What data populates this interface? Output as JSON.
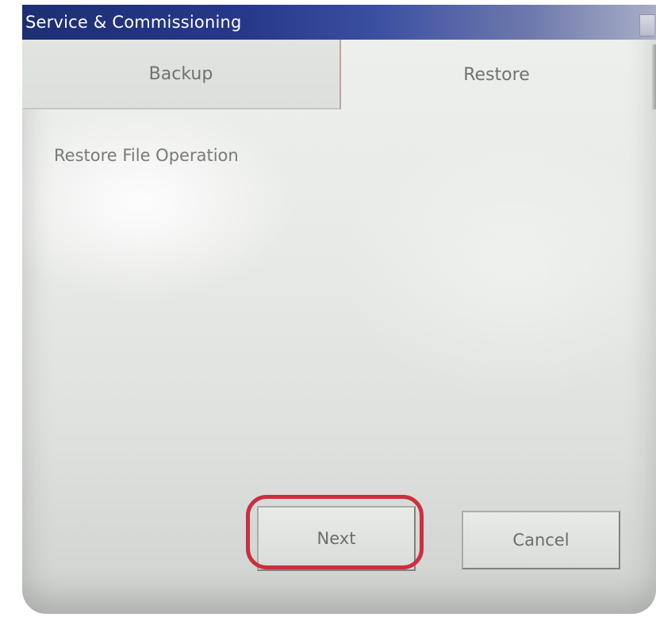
{
  "window": {
    "title": "Service & Commissioning"
  },
  "tabs": [
    {
      "label": "Backup",
      "selected": false
    },
    {
      "label": "Restore",
      "selected": true
    }
  ],
  "content": {
    "section_label": "Restore File Operation"
  },
  "buttons": {
    "next_label": "Next",
    "cancel_label": "Cancel"
  },
  "annotation": {
    "highlight_color": "#cc2f3d",
    "highlighted": "Next"
  },
  "colors": {
    "title_bar": "#27388a",
    "screen_background": "#e9ebe8"
  }
}
